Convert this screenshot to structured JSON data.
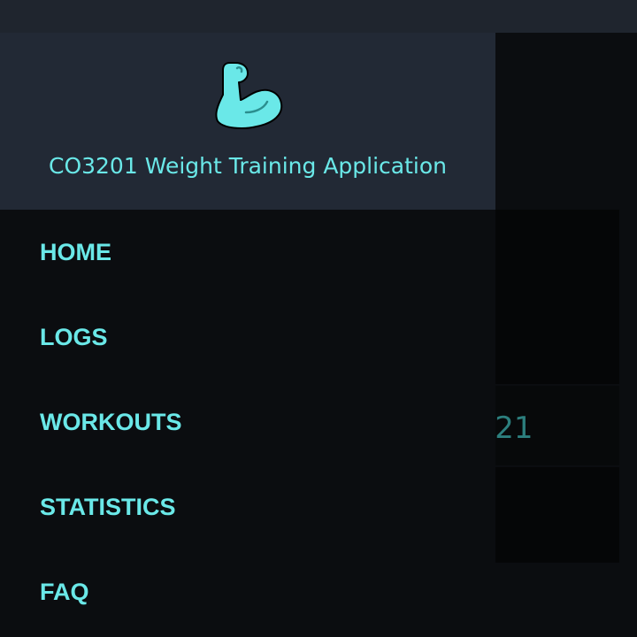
{
  "drawer": {
    "title": "CO3201 Weight Training Application",
    "logo_icon": "flexed-bicep-icon",
    "menu": [
      {
        "label": "HOME"
      },
      {
        "label": "LOGS"
      },
      {
        "label": "WORKOUTS"
      },
      {
        "label": "STATISTICS"
      },
      {
        "label": "FAQ"
      }
    ]
  },
  "background": {
    "partial_text": ")21"
  },
  "colors": {
    "accent": "#6ae8e8",
    "drawer_header": "#222935",
    "drawer_body": "#0b0d10",
    "top_bar": "#1f252e"
  }
}
